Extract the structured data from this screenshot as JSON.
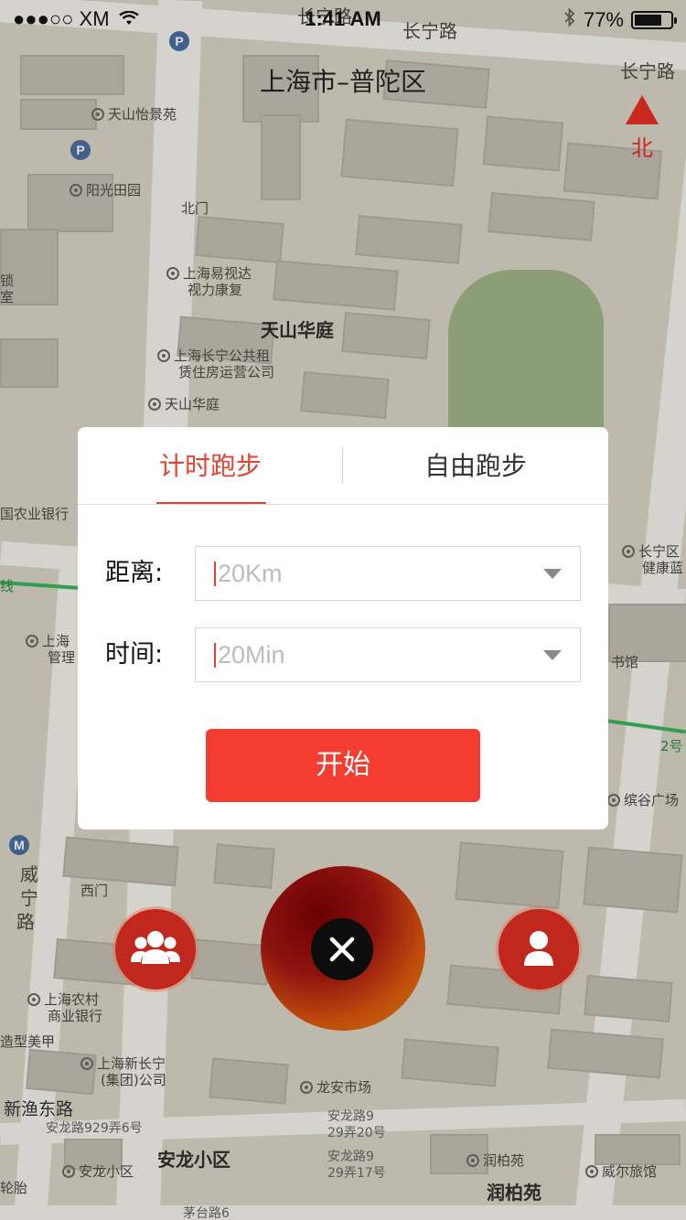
{
  "status_bar": {
    "carrier": "●●●○○ XM",
    "time": "1:41 AM",
    "battery": "77%",
    "battery_level": 0.77
  },
  "header": {
    "location": "上海市–普陀区",
    "compass_label": "北"
  },
  "map": {
    "labels": [
      "长宁路",
      "长宁路",
      "长宁路",
      "天山怡景苑",
      "阳光田园",
      "北门",
      "上海易视达",
      "视力康复",
      "天山华庭",
      "上海长宁公共租",
      "赁住房运营公司",
      "天山华庭",
      "国农业银行",
      "长宁区",
      "健康蓝",
      "线",
      "上海",
      "管理",
      "书馆",
      "2号",
      "缤谷广场",
      "威",
      "宁",
      "路",
      "西门",
      "上海农村",
      "商业银行",
      "造型美甲",
      "上海新长宁",
      "(集团)公司",
      "新渔东路",
      "安龙路929弄6号",
      "龙安市场",
      "安龙路9",
      "29弄20号",
      "安龙路9",
      "29弄17号",
      "安龙小区",
      "安龙小区",
      "润柏苑",
      "润柏苑",
      "威尔旅馆",
      "茅台路6",
      "轮胎",
      "锁",
      "室"
    ]
  },
  "dialog": {
    "tabs": [
      {
        "label": "计时跑步",
        "active": true
      },
      {
        "label": "自由跑步",
        "active": false
      }
    ],
    "distance": {
      "label": "距离:",
      "value": "20Km"
    },
    "time": {
      "label": "时间:",
      "value": "20Min"
    },
    "start_label": "开始"
  },
  "controls": {
    "left_icon": "group-icon",
    "center_icon": "close-icon",
    "right_icon": "person-icon"
  },
  "colors": {
    "accent": "#e8412f",
    "button": "#f43c30",
    "side_button": "#c0281e"
  }
}
